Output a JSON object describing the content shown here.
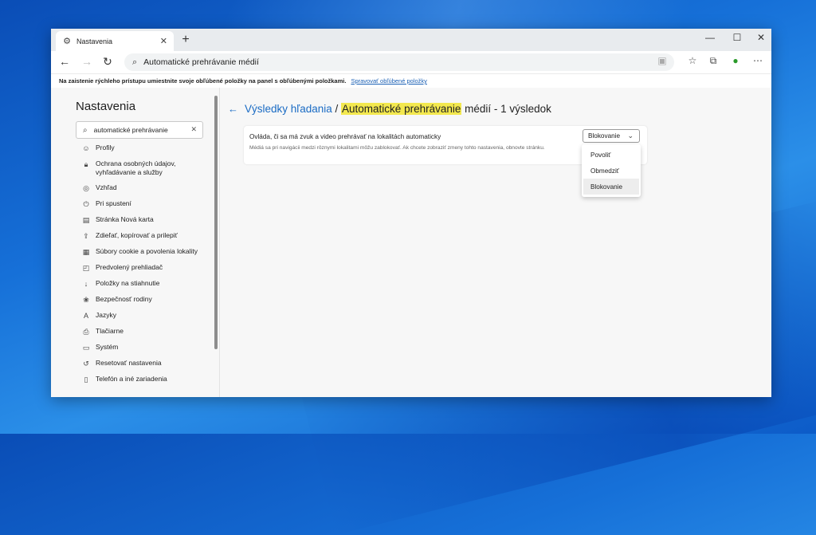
{
  "browser": {
    "tab_title": "Nastavenia",
    "address": "Automatické prehrávanie médií",
    "favorites_bar": {
      "prompt": "Na zaistenie rýchleho prístupu umiestnite svoje obľúbené položky na panel s obľúbenými položkami.",
      "link": "Spravovať obľúbené položky"
    }
  },
  "sidebar": {
    "title": "Nastavenia",
    "search_value": "automatické prehrávanie",
    "items": [
      {
        "icon": "profile-icon",
        "label": "Profily"
      },
      {
        "icon": "lock-icon",
        "label": "Ochrana osobných údajov, vyhľadávanie a služby"
      },
      {
        "icon": "palette-icon",
        "label": "Vzhľad"
      },
      {
        "icon": "power-icon",
        "label": "Pri spustení"
      },
      {
        "icon": "newtab-icon",
        "label": "Stránka Nová karta"
      },
      {
        "icon": "share-icon",
        "label": "Zdieľať, kopírovať a prilepiť"
      },
      {
        "icon": "cookie-icon",
        "label": "Súbory cookie a povolenia lokality"
      },
      {
        "icon": "browser-icon",
        "label": "Predvolený prehliadač"
      },
      {
        "icon": "download-icon",
        "label": "Položky na stiahnutie"
      },
      {
        "icon": "family-icon",
        "label": "Bezpečnosť rodiny"
      },
      {
        "icon": "language-icon",
        "label": "Jazyky"
      },
      {
        "icon": "printer-icon",
        "label": "Tlačiarne"
      },
      {
        "icon": "system-icon",
        "label": "Systém"
      },
      {
        "icon": "reset-icon",
        "label": "Resetovať nastavenia"
      },
      {
        "icon": "phone-icon",
        "label": "Telefón a iné zariadenia"
      }
    ]
  },
  "main": {
    "heading_link": "Výsledky hľadania",
    "heading_sep": " / ",
    "heading_highlight": "Automatické prehrávanie",
    "heading_rest": " médií - 1 výsledok",
    "card": {
      "title": "Ovláda, či sa má zvuk a video prehrávať na lokalitách automaticky",
      "description": "Médiá sa pri navigácii medzi rôznymi lokalitami môžu zablokovať. Ak chcete zobraziť zmeny tohto nastavenia, obnovte stránku."
    },
    "select_value": "Blokovanie",
    "options": [
      "Povoliť",
      "Obmedziť",
      "Blokovanie"
    ],
    "selected_index": 2
  },
  "colors": {
    "highlight": "#f3e84f",
    "link": "#1a6bc4"
  }
}
